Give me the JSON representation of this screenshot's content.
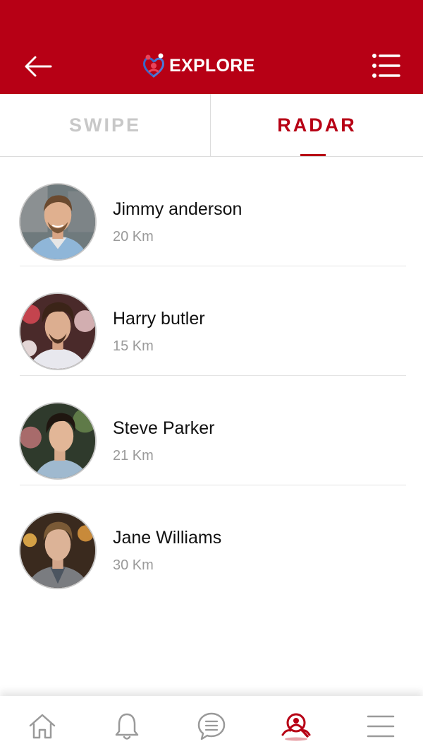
{
  "header": {
    "title": "EXPLORE",
    "back_icon": "arrow-left-icon",
    "menu_icon": "list-icon",
    "background": "#b70015"
  },
  "tabs": [
    {
      "label": "SWIPE",
      "active": false
    },
    {
      "label": "RADAR",
      "active": true
    }
  ],
  "people": [
    {
      "name": "Jimmy anderson",
      "distance": "20 Km"
    },
    {
      "name": "Harry butler",
      "distance": "15 Km"
    },
    {
      "name": "Steve Parker",
      "distance": "21 Km"
    },
    {
      "name": "Jane Williams",
      "distance": "30 Km"
    }
  ],
  "bottom_nav": [
    {
      "icon": "home-icon",
      "active": false
    },
    {
      "icon": "bell-icon",
      "active": false
    },
    {
      "icon": "chat-icon",
      "active": false
    },
    {
      "icon": "radar-people-icon",
      "active": true
    },
    {
      "icon": "hamburger-menu-icon",
      "active": false
    }
  ],
  "colors": {
    "accent": "#b70015",
    "inactive_tab": "#c8c8c8",
    "nav_icon": "#9a9a9a"
  }
}
